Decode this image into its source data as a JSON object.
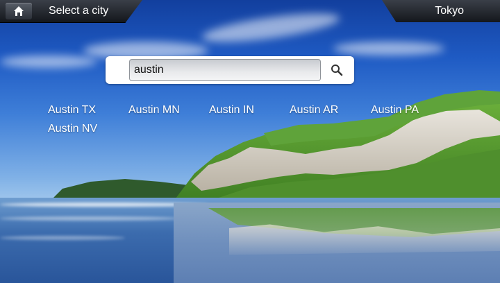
{
  "header": {
    "title": "Select a city",
    "current_city": "Tokyo"
  },
  "icons": {
    "home": "home-icon",
    "search": "search-icon"
  },
  "search": {
    "value": "austin"
  },
  "results": [
    "Austin TX",
    "Austin MN",
    "Austin IN",
    "Austin AR",
    "Austin PA",
    "Austin NV"
  ],
  "colors": {
    "bar": "#1a1d22",
    "text": "#ffffff",
    "sky": "#1f5bc4"
  }
}
